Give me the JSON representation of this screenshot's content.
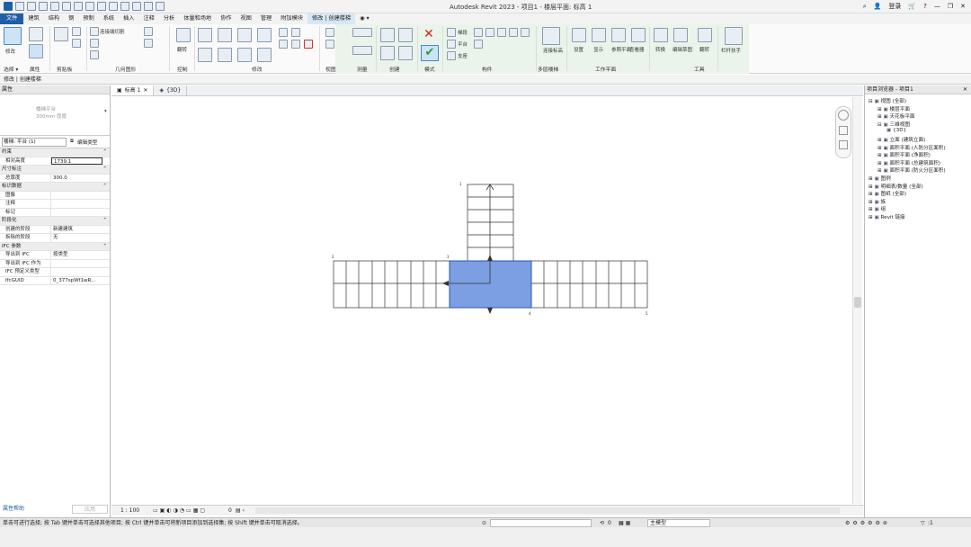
{
  "app": {
    "title": "Autodesk Revit 2023 - 项目1 - 楼层平面: 标高 1",
    "user": "登录"
  },
  "menu_tabs": [
    "文件",
    "建筑",
    "结构",
    "钢",
    "预制",
    "系统",
    "插入",
    "注释",
    "分析",
    "体量和场地",
    "协作",
    "视图",
    "管理",
    "附加模块",
    "修改 | 创建楼梯"
  ],
  "ribbon": {
    "select_label": "修改",
    "panels": {
      "select": "选择 ▾",
      "properties": "属性",
      "clipboard": "剪贴板",
      "geometry": "几何图形",
      "control": "控制",
      "modify": "修改",
      "view": "视图",
      "measure": "测量",
      "create": "创建",
      "mode": "模式",
      "components": "构件",
      "multistory": "多层楼梯",
      "workplane": "工作平面",
      "tools": "工具"
    },
    "labels": {
      "connect": "连接端切割",
      "flip": "翻转",
      "run": "梯段",
      "landing": "平台",
      "support": "支座",
      "connect_levels": "连接标高",
      "set": "设置",
      "show": "显示",
      "ref_plane": "参照平面",
      "viewer": "查看器",
      "convert": "转换",
      "edit_sketch": "编辑草图",
      "railing": "栏杆扶手"
    }
  },
  "option_bar": "修改 | 创建楼梯",
  "properties": {
    "header": "属性",
    "type_name": "楼梯平台",
    "type_sub": "300mm 厚度",
    "selector": "楼梯: 平台 (1)",
    "edit_type": "编辑类型",
    "rows": [
      {
        "group": "约束"
      },
      {
        "k": "相对高度",
        "v": "1739.1",
        "box": true
      },
      {
        "group": "尺寸标注"
      },
      {
        "k": "总厚度",
        "v": "300.0"
      },
      {
        "group": "标识数据"
      },
      {
        "k": "图像",
        "v": ""
      },
      {
        "k": "注释",
        "v": ""
      },
      {
        "k": "标记",
        "v": ""
      },
      {
        "group": "阶段化"
      },
      {
        "k": "创建的阶段",
        "v": "新建建筑"
      },
      {
        "k": "拆除的阶段",
        "v": "无"
      },
      {
        "group": "IFC 参数"
      },
      {
        "k": "导出到 IFC",
        "v": "按类型"
      },
      {
        "k": "导出到 IFC 作为",
        "v": ""
      },
      {
        "k": "IFC 预定义类型",
        "v": ""
      },
      {
        "k": "IfcGUID",
        "v": "0_377spWf1wR..."
      }
    ],
    "help": "属性帮助",
    "apply": "应用"
  },
  "view_tabs": [
    {
      "label": "标高 1",
      "active": true
    },
    {
      "label": "{3D}",
      "active": false
    }
  ],
  "browser": {
    "header": "项目浏览器 - 项目1",
    "items": [
      {
        "label": "视图 (全部)",
        "indent": 0
      },
      {
        "label": "楼层平面",
        "indent": 1
      },
      {
        "label": "天花板平面",
        "indent": 1
      },
      {
        "label": "三维视图",
        "indent": 1
      },
      {
        "label": "{3D}",
        "indent": 2
      },
      {
        "label": "立面 (建筑立面)",
        "indent": 1
      },
      {
        "label": "面积平面 (人防分区面积)",
        "indent": 1
      },
      {
        "label": "面积平面 (净面积)",
        "indent": 1
      },
      {
        "label": "面积平面 (总建筑面积)",
        "indent": 1
      },
      {
        "label": "面积平面 (防火分区面积)",
        "indent": 1
      },
      {
        "label": "图例",
        "indent": 0
      },
      {
        "label": "明细表/数量 (全部)",
        "indent": 0
      },
      {
        "label": "图纸 (全部)",
        "indent": 0
      },
      {
        "label": "族",
        "indent": 0
      },
      {
        "label": "组",
        "indent": 0
      },
      {
        "label": "Revit 链接",
        "indent": 0
      }
    ]
  },
  "view_control": {
    "scale": "1 : 100",
    "detail": "0"
  },
  "status": {
    "text": "单击可进行选择; 按 Tab 键并单击可选择其他项目; 按 Ctrl 键并单击可将新项目添加到选择集; 按 Shift 键并单击可取消选择。",
    "main_model": "主模型",
    "count": "0",
    "filter": ":1"
  },
  "drawing": {
    "labels": [
      "1",
      "2",
      "3",
      "4",
      "5"
    ]
  },
  "colors": {
    "file_tab": "#1f5fa8",
    "landing_fill": "#7c9ee2",
    "context_tab": "#d6e8f5",
    "ribbon_context": "#eaf4ea"
  }
}
